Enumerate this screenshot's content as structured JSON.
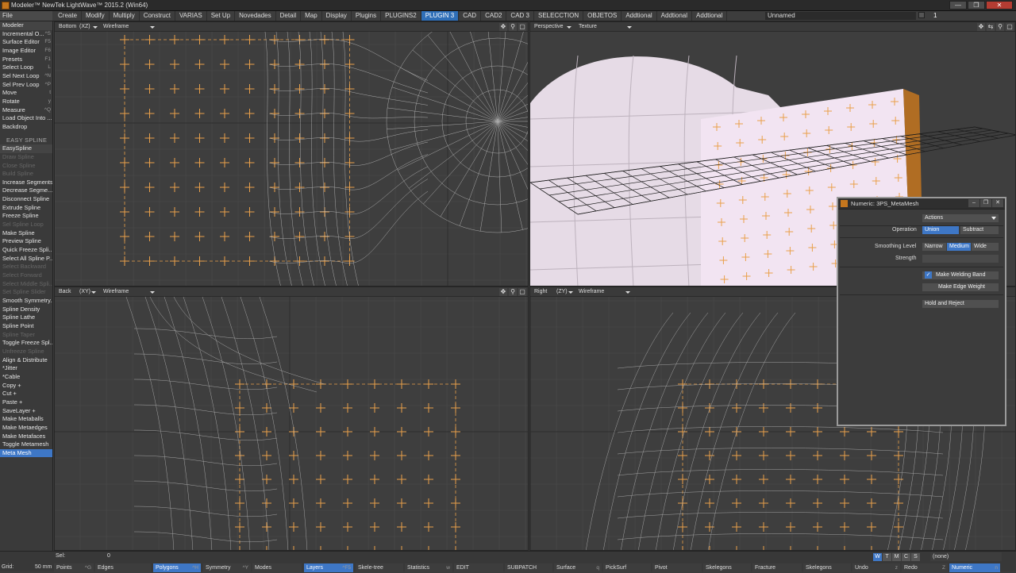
{
  "window": {
    "title": "Modeler™ NewTek LightWave™ 2015.2 (Win64)",
    "controls": [
      "—",
      "❐",
      "✕"
    ]
  },
  "menubar": {
    "file": "File",
    "tabs": [
      "Create",
      "Modify",
      "Multiply",
      "Construct",
      "VARIAS",
      "Set Up",
      "Novedades",
      "Detail",
      "Map",
      "Display",
      "Plugins",
      "PLUGINS2",
      "PLUGIN 3",
      "CAD",
      "CAD2",
      "CAD 3",
      "SELECCTION",
      "OBJETOS",
      "Addtional",
      "Addtional",
      "Addtional"
    ],
    "active_tab": "PLUGIN 3",
    "object": "Unnamed",
    "layer_number": "1"
  },
  "sidebar": {
    "items": [
      {
        "label": "Modeler",
        "key": "",
        "kind": "btn"
      },
      {
        "label": "Incremental O...",
        "key": "^S"
      },
      {
        "label": "Surface Editor",
        "key": "F5"
      },
      {
        "label": "Image Editor",
        "key": "F6"
      },
      {
        "label": "Presets",
        "key": "F1"
      },
      {
        "label": "Select Loop",
        "key": "L"
      },
      {
        "label": "Sel Next Loop",
        "key": "^N"
      },
      {
        "label": "Sel Prev Loop",
        "key": "^P"
      },
      {
        "label": "Move",
        "key": "t"
      },
      {
        "label": "Rotate",
        "key": "y"
      },
      {
        "label": "Measure",
        "key": "^Q"
      },
      {
        "label": "Load Object Into ...",
        "key": ""
      },
      {
        "label": "Backdrop",
        "key": ""
      },
      {
        "label": "",
        "kind": "gap"
      },
      {
        "label": "EASY SPLINE",
        "kind": "hdr"
      },
      {
        "label": "EasySpline",
        "key": "",
        "kind": "btn"
      },
      {
        "label": "Draw Spline",
        "kind": "dim"
      },
      {
        "label": "Close Spline",
        "kind": "dim"
      },
      {
        "label": "Build Spline",
        "kind": "dim"
      },
      {
        "label": "Increase Segments",
        "key": ""
      },
      {
        "label": "Decrease Segme...",
        "key": ""
      },
      {
        "label": "Disconnect Spline",
        "key": ""
      },
      {
        "label": "Extrude Spline",
        "key": ""
      },
      {
        "label": "Freeze Spline",
        "key": ""
      },
      {
        "label": "Sel Spline Loop",
        "kind": "dim"
      },
      {
        "label": "Make Spline",
        "key": ""
      },
      {
        "label": "Preview Spline",
        "key": ""
      },
      {
        "label": "Quick Freeze Spli...",
        "key": ""
      },
      {
        "label": "Select All Spline P...",
        "key": ""
      },
      {
        "label": "Select Backward",
        "kind": "dim"
      },
      {
        "label": "Select Forward",
        "kind": "dim"
      },
      {
        "label": "Select Middle Spli...",
        "kind": "dim"
      },
      {
        "label": "Set Spline Slider",
        "kind": "dim"
      },
      {
        "label": "Smooth Symmetry...",
        "key": ""
      },
      {
        "label": "Spline Density",
        "key": ""
      },
      {
        "label": "Spline Lathe",
        "key": ""
      },
      {
        "label": "Spline Point",
        "key": ""
      },
      {
        "label": "Spline Taper",
        "kind": "dim"
      },
      {
        "label": "Toggle Freeze Spl...",
        "key": ""
      },
      {
        "label": "Unfreeze Spline",
        "kind": "dim"
      },
      {
        "label": "Align & Distribute",
        "key": ""
      },
      {
        "label": "*Jitter",
        "key": ""
      },
      {
        "label": "*Cable",
        "key": ""
      },
      {
        "label": "Copy +",
        "key": ""
      },
      {
        "label": "Cut +",
        "key": ""
      },
      {
        "label": "Paste +",
        "key": ""
      },
      {
        "label": "SaveLayer +",
        "key": ""
      },
      {
        "label": "Make Metaballs",
        "key": ""
      },
      {
        "label": "Make Metaedges",
        "key": ""
      },
      {
        "label": "Make Metafaces",
        "key": ""
      },
      {
        "label": "Toggle Metamesh",
        "key": ""
      },
      {
        "label": "Meta Mesh",
        "key": "",
        "kind": "sel"
      }
    ]
  },
  "viewports": {
    "top_left": {
      "view": "Bottom",
      "axes": "(XZ)",
      "mode": "Wireframe"
    },
    "top_right": {
      "view": "Perspective",
      "mode": "Texture"
    },
    "bottom_left": {
      "view": "Back",
      "axes": "(XY)",
      "mode": "Wireframe"
    },
    "bottom_right": {
      "view": "Right",
      "axes": "(ZY)",
      "mode": "Wireframe"
    },
    "icons": [
      "move-icon",
      "zoom-icon",
      "maximize-icon"
    ]
  },
  "numeric": {
    "title": "Numeric: 3PS_MetaMesh",
    "actions": "Actions",
    "operation_label": "Operation",
    "operation_options": [
      "Union",
      "Subtract"
    ],
    "operation_selected": "Union",
    "smoothing_label": "Smoothing Level",
    "smoothing_options": [
      "Narrow",
      "Medium",
      "Wide"
    ],
    "smoothing_selected": "Medium",
    "strength_label": "Strength",
    "make_welding_band": "Make Welding Band",
    "make_welding_band_checked": true,
    "make_edge_weight": "Make Edge Weight",
    "hold_and_reject": "Hold and Reject"
  },
  "statusbar": {
    "sel_label": "Sel:",
    "sel_value": "0",
    "grid_label": "Grid:",
    "grid_value": "50 mm",
    "modes": [
      "W",
      "T",
      "M",
      "C",
      "S"
    ],
    "active_mode": "W",
    "surface": "(none)",
    "tools": [
      {
        "label": "Points",
        "key": "^G"
      },
      {
        "label": "Edges",
        "key": ""
      },
      {
        "label": "Polygons",
        "key": "^H",
        "active": true
      },
      {
        "label": "Symmetry",
        "key": "^Y"
      },
      {
        "label": "Modes",
        "key": ""
      },
      {
        "label": "Layers",
        "key": "^F5",
        "active": true
      },
      {
        "label": "Skele-tree",
        "key": ""
      },
      {
        "label": "Statistics",
        "key": "w"
      },
      {
        "label": "EDIT",
        "key": ""
      },
      {
        "label": "SUBPATCH",
        "key": ""
      },
      {
        "label": "Surface",
        "key": "q"
      },
      {
        "label": "PickSurf",
        "key": ""
      },
      {
        "label": "Pivot",
        "key": ""
      },
      {
        "label": "Skelegons",
        "key": ""
      },
      {
        "label": "Fracture",
        "key": ""
      },
      {
        "label": "Skelegons",
        "key": ""
      },
      {
        "label": "Undo",
        "key": "z"
      },
      {
        "label": "Redo",
        "key": "Z"
      },
      {
        "label": "Numeric",
        "key": "n",
        "active": true
      }
    ]
  },
  "colors": {
    "accent": "#3e77c6",
    "points": "#e9a04a",
    "mesh": "#cfcfcf"
  }
}
